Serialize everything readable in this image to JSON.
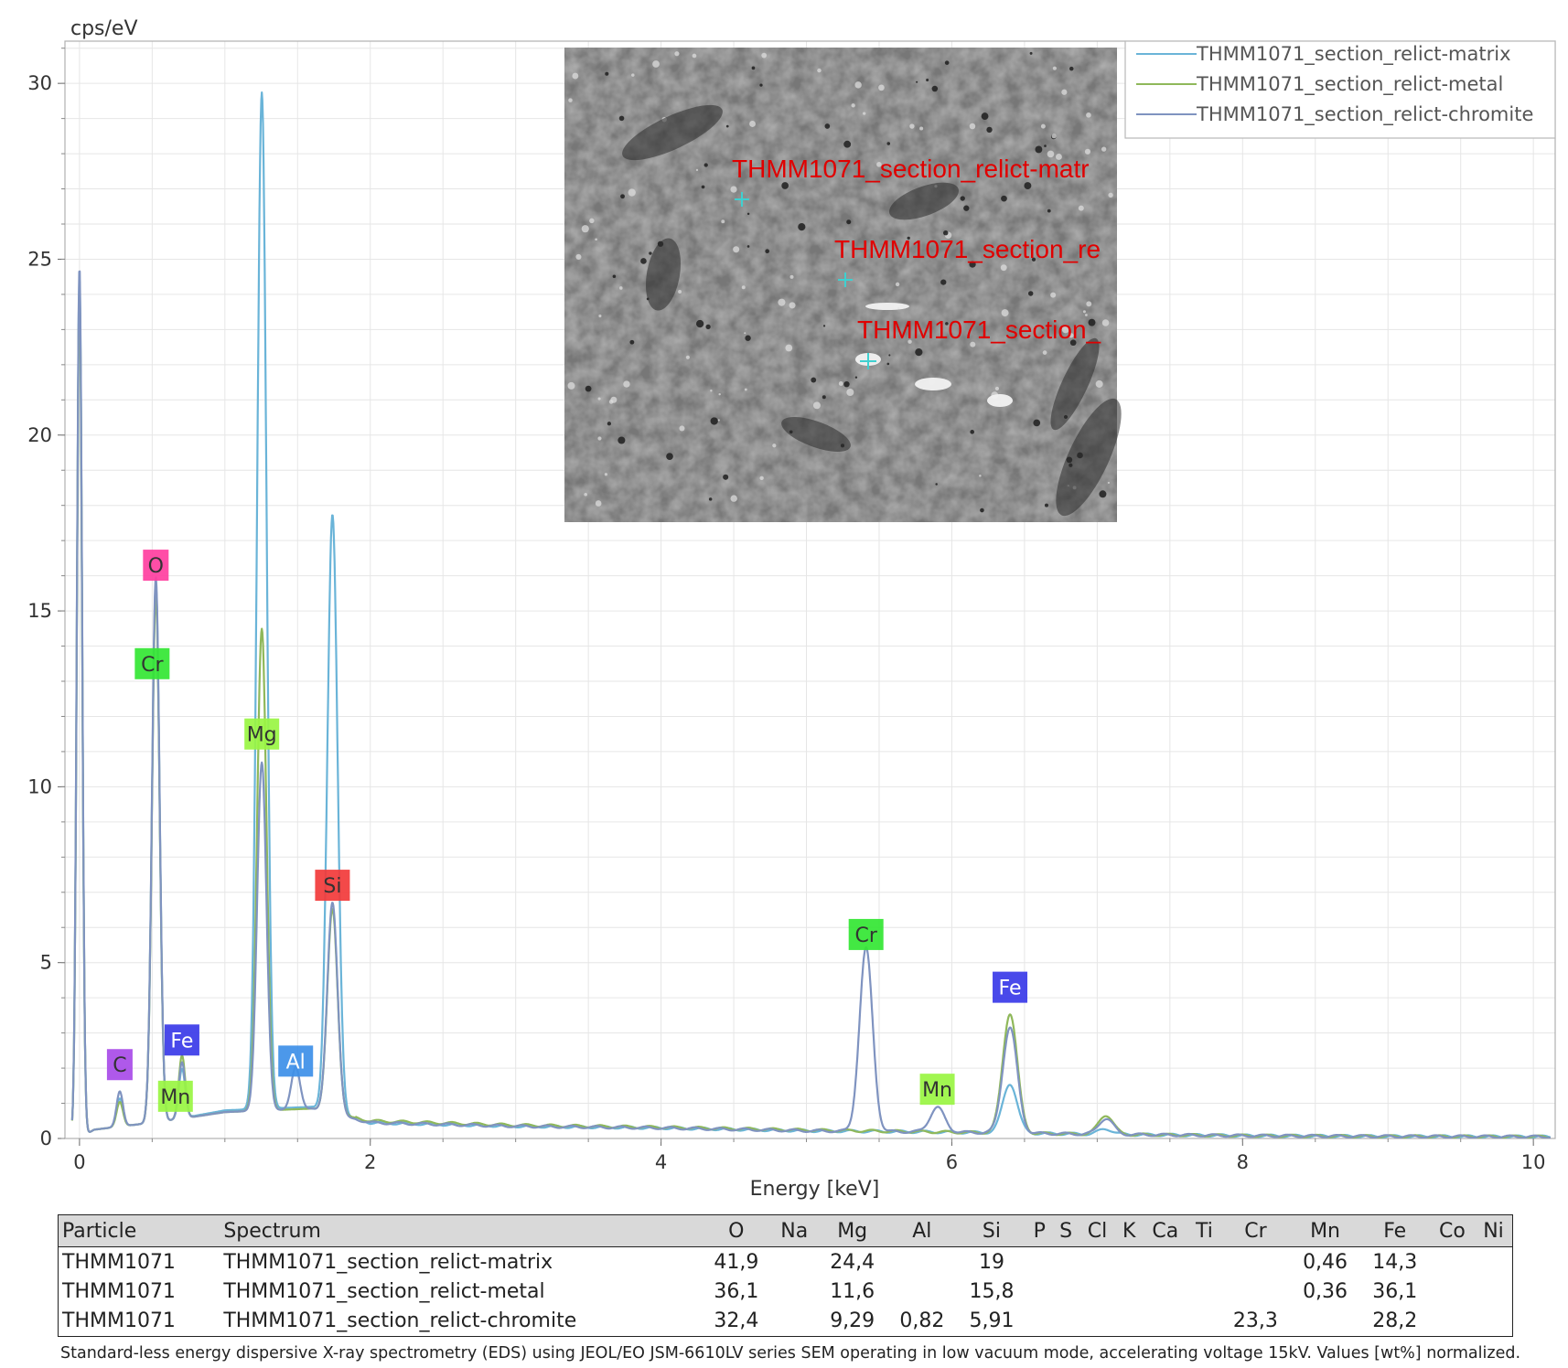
{
  "chart_data": {
    "type": "line",
    "ylabel": "cps/eV",
    "xlabel": "Energy [keV]",
    "xlim": [
      -0.1,
      10.15
    ],
    "ylim": [
      0,
      31.2
    ],
    "x_ticks": [
      0,
      2,
      4,
      6,
      8,
      10
    ],
    "y_ticks": [
      0,
      5,
      10,
      15,
      20,
      25,
      30
    ],
    "grid": true,
    "legend_position": "top-right",
    "series": [
      {
        "name": "THMM1071_section_relict-matrix",
        "color": "#6ab4d8",
        "baseline": [
          [
            0.0,
            0.0
          ],
          [
            0.1,
            0.25
          ],
          [
            0.3,
            0.35
          ],
          [
            0.6,
            0.5
          ],
          [
            1.0,
            0.8
          ],
          [
            1.6,
            0.9
          ],
          [
            2.0,
            0.45
          ],
          [
            3.0,
            0.35
          ],
          [
            4.0,
            0.3
          ],
          [
            5.0,
            0.22
          ],
          [
            6.0,
            0.18
          ],
          [
            7.0,
            0.12
          ],
          [
            8.0,
            0.08
          ],
          [
            9.0,
            0.06
          ],
          [
            10.1,
            0.05
          ]
        ],
        "peaks": [
          {
            "x": 0.0,
            "y": 24.5,
            "w": 0.018
          },
          {
            "x": 0.277,
            "y": 0.8,
            "w": 0.022
          },
          {
            "x": 0.525,
            "y": 15.3,
            "w": 0.026
          },
          {
            "x": 0.705,
            "y": 1.4,
            "w": 0.022
          },
          {
            "x": 1.254,
            "y": 28.9,
            "w": 0.032
          },
          {
            "x": 1.74,
            "y": 17.0,
            "w": 0.035
          },
          {
            "x": 6.4,
            "y": 1.4,
            "w": 0.05
          },
          {
            "x": 7.06,
            "y": 0.15,
            "w": 0.05
          }
        ]
      },
      {
        "name": "THMM1071_section_relict-metal",
        "color": "#8fb85a",
        "baseline": [
          [
            0.0,
            0.0
          ],
          [
            0.1,
            0.25
          ],
          [
            0.3,
            0.35
          ],
          [
            0.6,
            0.5
          ],
          [
            1.0,
            0.75
          ],
          [
            1.6,
            0.85
          ],
          [
            2.0,
            0.5
          ],
          [
            3.0,
            0.38
          ],
          [
            4.0,
            0.32
          ],
          [
            5.0,
            0.24
          ],
          [
            6.0,
            0.18
          ],
          [
            7.0,
            0.12
          ],
          [
            8.0,
            0.08
          ],
          [
            9.0,
            0.06
          ],
          [
            10.1,
            0.05
          ]
        ],
        "peaks": [
          {
            "x": 0.0,
            "y": 24.2,
            "w": 0.018
          },
          {
            "x": 0.277,
            "y": 0.7,
            "w": 0.022
          },
          {
            "x": 0.525,
            "y": 15.0,
            "w": 0.026
          },
          {
            "x": 0.705,
            "y": 1.8,
            "w": 0.022
          },
          {
            "x": 1.254,
            "y": 13.7,
            "w": 0.032
          },
          {
            "x": 1.74,
            "y": 5.8,
            "w": 0.035
          },
          {
            "x": 6.4,
            "y": 3.4,
            "w": 0.05
          },
          {
            "x": 7.06,
            "y": 0.55,
            "w": 0.05
          }
        ]
      },
      {
        "name": "THMM1071_section_relict-chromite",
        "color": "#7f93c0",
        "baseline": [
          [
            0.0,
            0.0
          ],
          [
            0.1,
            0.25
          ],
          [
            0.3,
            0.35
          ],
          [
            0.6,
            0.5
          ],
          [
            1.0,
            0.75
          ],
          [
            1.6,
            0.85
          ],
          [
            2.0,
            0.45
          ],
          [
            3.0,
            0.35
          ],
          [
            4.0,
            0.3
          ],
          [
            5.0,
            0.22
          ],
          [
            6.0,
            0.18
          ],
          [
            7.0,
            0.12
          ],
          [
            8.0,
            0.08
          ],
          [
            9.0,
            0.06
          ],
          [
            10.1,
            0.05
          ]
        ],
        "peaks": [
          {
            "x": 0.0,
            "y": 24.8,
            "w": 0.018
          },
          {
            "x": 0.277,
            "y": 1.0,
            "w": 0.022
          },
          {
            "x": 0.525,
            "y": 15.5,
            "w": 0.026
          },
          {
            "x": 0.705,
            "y": 1.6,
            "w": 0.022
          },
          {
            "x": 1.254,
            "y": 9.9,
            "w": 0.032
          },
          {
            "x": 1.487,
            "y": 1.2,
            "w": 0.03
          },
          {
            "x": 1.74,
            "y": 6.0,
            "w": 0.035
          },
          {
            "x": 5.41,
            "y": 5.2,
            "w": 0.045
          },
          {
            "x": 5.9,
            "y": 0.7,
            "w": 0.05
          },
          {
            "x": 6.4,
            "y": 3.0,
            "w": 0.05
          },
          {
            "x": 7.06,
            "y": 0.45,
            "w": 0.05
          }
        ]
      }
    ],
    "peak_labels": [
      {
        "text": "O",
        "x": 0.525,
        "y": 16.3,
        "color": "#ff3fa0"
      },
      {
        "text": "Cr",
        "x": 0.5,
        "y": 13.5,
        "color": "#33e633"
      },
      {
        "text": "Mg",
        "x": 1.254,
        "y": 11.5,
        "color": "#99f542"
      },
      {
        "text": "Si",
        "x": 1.74,
        "y": 7.2,
        "color": "#f23a3a"
      },
      {
        "text": "C",
        "x": 0.277,
        "y": 2.1,
        "color": "#a84be8"
      },
      {
        "text": "Fe",
        "x": 0.705,
        "y": 2.8,
        "color": "#3a3ae8"
      },
      {
        "text": "Mn",
        "x": 0.66,
        "y": 1.2,
        "color": "#99f542"
      },
      {
        "text": "Al",
        "x": 1.487,
        "y": 2.2,
        "color": "#3d8fe8"
      },
      {
        "text": "Cr",
        "x": 5.41,
        "y": 5.8,
        "color": "#33e633"
      },
      {
        "text": "Mn",
        "x": 5.9,
        "y": 1.4,
        "color": "#99f542"
      },
      {
        "text": "Fe",
        "x": 6.4,
        "y": 4.3,
        "color": "#3a3ae8"
      }
    ]
  },
  "sem_image": {
    "labels": [
      "THMM1071_section_relict-matr",
      "THMM1071_section_re",
      "THMM1071_section_"
    ]
  },
  "table": {
    "headers": [
      "Particle",
      "Spectrum",
      "O",
      "Na",
      "Mg",
      "Al",
      "Si",
      "P",
      "S",
      "Cl",
      "K",
      "Ca",
      "Ti",
      "Cr",
      "Mn",
      "Fe",
      "Co",
      "Ni"
    ],
    "rows": [
      [
        "THMM1071",
        "THMM1071_section_relict-matrix",
        "41,9",
        "",
        "24,4",
        "",
        "19",
        "",
        "",
        "",
        "",
        "",
        "",
        "",
        "0,46",
        "14,3",
        "",
        ""
      ],
      [
        "THMM1071",
        "THMM1071_section_relict-metal",
        "36,1",
        "",
        "11,6",
        "",
        "15,8",
        "",
        "",
        "",
        "",
        "",
        "",
        "",
        "0,36",
        "36,1",
        "",
        ""
      ],
      [
        "THMM1071",
        "THMM1071_section_relict-chromite",
        "32,4",
        "",
        "9,29",
        "0,82",
        "5,91",
        "",
        "",
        "",
        "",
        "",
        "",
        "23,3",
        "",
        "28,2",
        "",
        ""
      ]
    ]
  },
  "footnote": "Standard-less energy dispersive X-ray spectrometry (EDS) using JEOL/EO JSM-6610LV series SEM operating in low vacuum mode, accelerating voltage 15kV. Values [wt%] normalized."
}
